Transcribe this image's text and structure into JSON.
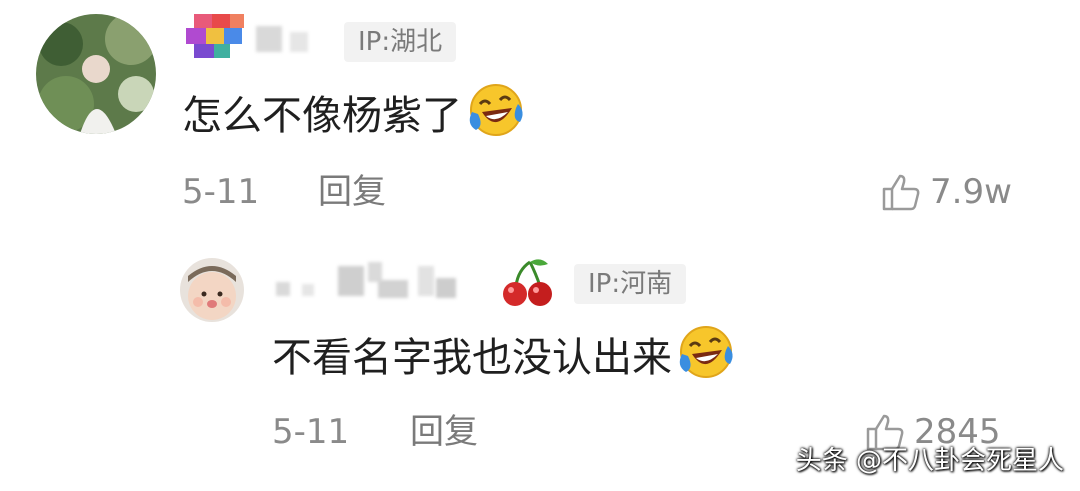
{
  "comments": [
    {
      "ip": "IP:湖北",
      "text": "怎么不像杨紫了",
      "date": "5-11",
      "reply": "回复",
      "likes": "7.9w"
    },
    {
      "ip": "IP:河南",
      "text": "不看名字我也没认出来",
      "date": "5-11",
      "reply": "回复",
      "likes": "2845"
    }
  ],
  "watermark": "头条 @不八卦会死星人",
  "emoji": "laughing-crying-emoji",
  "colors": {
    "meta_gray": "#8a8a8a",
    "ip_badge_bg": "#f2f2f2",
    "text": "#1f1f1f"
  }
}
